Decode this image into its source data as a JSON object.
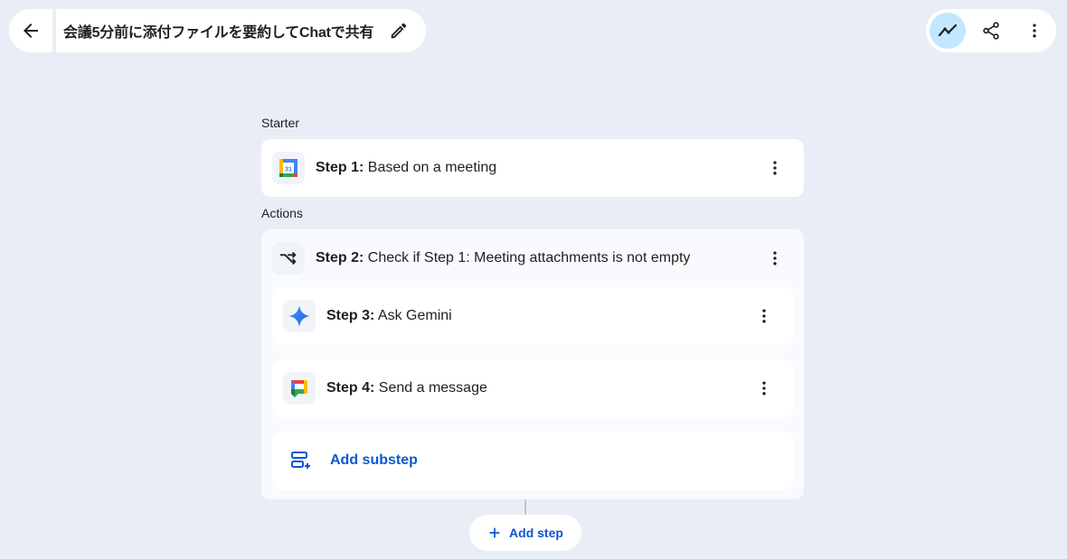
{
  "header": {
    "title": "会議5分前に添付ファイルを要約してChatで共有",
    "back_icon": "arrow-back-icon",
    "edit_icon": "pencil-icon",
    "activity_icon": "activity-icon",
    "share_icon": "share-icon",
    "more_icon": "more-vert-icon"
  },
  "starter": {
    "section_label": "Starter",
    "step": {
      "prefix": "Step 1:",
      "text": " Based on a meeting",
      "icon": "google-calendar-icon",
      "calendar_day": "31"
    }
  },
  "actions": {
    "section_label": "Actions",
    "condition": {
      "prefix": "Step 2:",
      "text": " Check if Step 1: Meeting attachments is not empty",
      "icon": "condition-branch-icon"
    },
    "substeps": [
      {
        "prefix": "Step 3:",
        "text": " Ask Gemini",
        "icon": "gemini-sparkle-icon"
      },
      {
        "prefix": "Step 4:",
        "text": " Send a message",
        "icon": "google-chat-icon"
      }
    ],
    "add_substep_label": "Add substep",
    "add_substep_icon": "add-substep-icon"
  },
  "add_step": {
    "label": "Add step",
    "icon": "plus-icon"
  },
  "colors": {
    "background": "#e9eef6",
    "accent": "#0b57d0",
    "active": "#c2e7ff"
  }
}
